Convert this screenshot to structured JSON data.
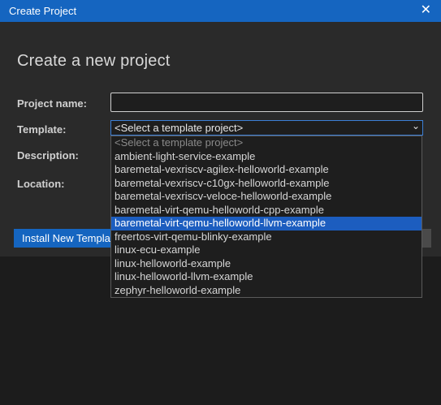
{
  "window": {
    "title": "Create Project",
    "close_glyph": "✕"
  },
  "dialog": {
    "heading": "Create a new project",
    "labels": {
      "project_name": "Project name:",
      "template": "Template:",
      "description": "Description:",
      "location": "Location:"
    },
    "project_name_value": "",
    "template_select": {
      "selected": "<Select a template project>",
      "chevron_icon": "chevron-down-icon"
    },
    "install_button": "Install New Template"
  },
  "dropdown": {
    "options": [
      "<Select a template project>",
      "ambient-light-service-example",
      "baremetal-vexriscv-agilex-helloworld-example",
      "baremetal-vexriscv-c10gx-helloworld-example",
      "baremetal-vexriscv-veloce-helloworld-example",
      "baremetal-virt-qemu-helloworld-cpp-example",
      "baremetal-virt-qemu-helloworld-llvm-example",
      "freertos-virt-qemu-blinky-example",
      "linux-ecu-example",
      "linux-helloworld-example",
      "linux-helloworld-llvm-example",
      "zephyr-helloworld-example"
    ],
    "highlighted_index": 6
  },
  "colors": {
    "accent": "#1565c0",
    "highlight": "#1c5dbf",
    "background": "#2a2a2a"
  }
}
